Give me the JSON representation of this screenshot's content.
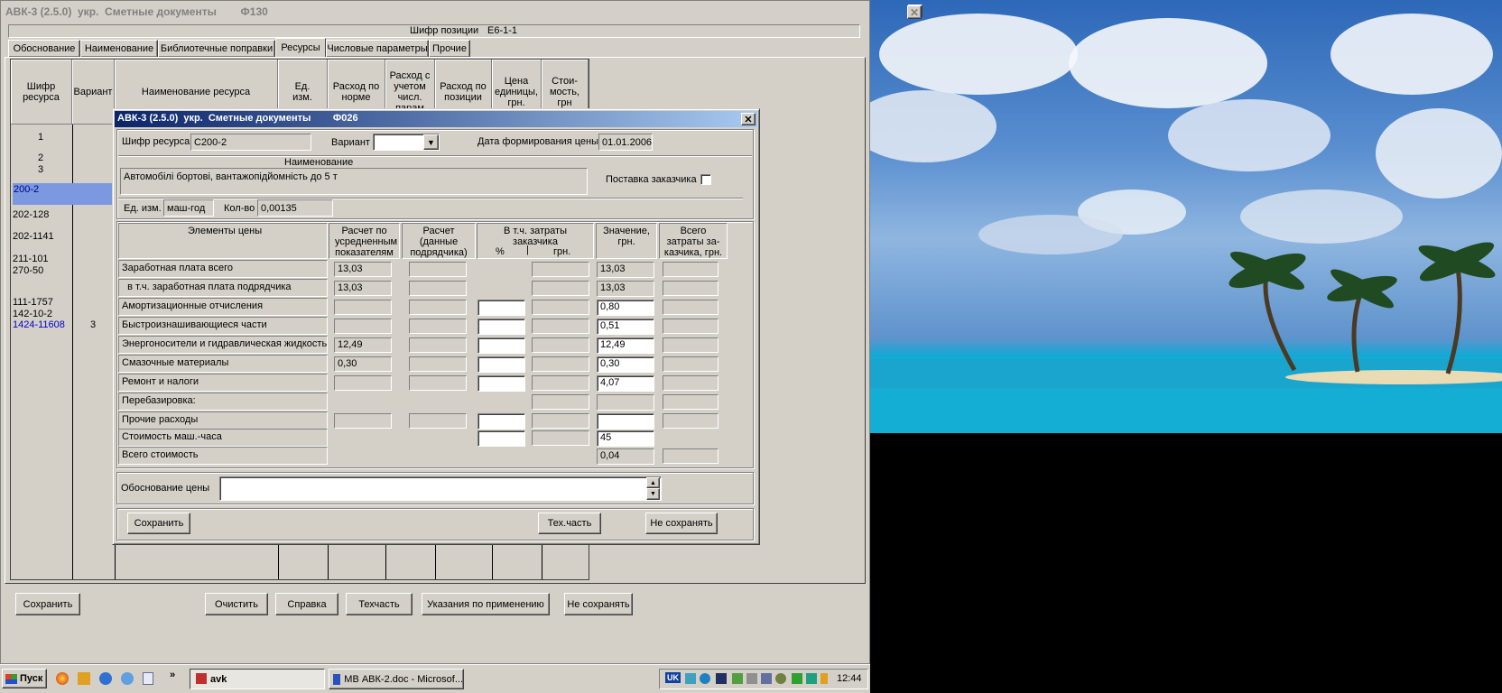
{
  "main_window": {
    "title": "АВК-3 (2.5.0)  укр.  Сметные документы        Ф130",
    "position_code_label": "Шифр позиции",
    "position_code": "Е6-1-1",
    "tabs": [
      "Обоснование",
      "Наименование",
      "Библиотечные поправки",
      "Ресурсы",
      "Числовые параметры",
      "Прочие"
    ],
    "active_tab": "Ресурсы",
    "table_headers": [
      "Шифр ресурса",
      "Вариант",
      "Наименование ресурса",
      "Ед. изм.",
      "Расход по норме",
      "Расход с учетом числ. парам",
      "Расход по позиции",
      "Цена единицы, грн.",
      "Стои- мость, грн"
    ],
    "resource_rows": [
      {
        "code": "1",
        "variant": ""
      },
      {
        "code": "2",
        "variant": ""
      },
      {
        "code": "3",
        "variant": ""
      },
      {
        "code": "200-2",
        "variant": "",
        "selected": true
      },
      {
        "code": "202-128",
        "variant": ""
      },
      {
        "code": "202-1141",
        "variant": ""
      },
      {
        "code": "211-101",
        "variant": ""
      },
      {
        "code": "270-50",
        "variant": ""
      },
      {
        "code": "111-1757",
        "variant": ""
      },
      {
        "code": "142-10-2",
        "variant": ""
      },
      {
        "code": "1424-11608",
        "variant": "3",
        "blue": true
      }
    ],
    "buttons": {
      "save": "Сохранить",
      "clear": "Очистить",
      "help": "Справка",
      "techpart": "Техчасть",
      "usage": "Указания по применению",
      "nosave": "Не сохранять"
    }
  },
  "dialog": {
    "title": "АВК-3 (2.5.0)  укр.  Сметные документы        Ф026",
    "resource_code_label": "Шифр ресурса",
    "resource_code": "С200-2",
    "variant_label": "Вариант",
    "variant_value": "",
    "price_date_label": "Дата формирования цены",
    "price_date": "01.01.2006",
    "name_label": "Наименование",
    "name_value": "Автомобілі бортові, вантажопідйомність до 5 т",
    "customer_supply_label": "Поставка заказчика",
    "unit_label": "Ед. изм.",
    "unit_value": "маш-год",
    "qty_label": "Кол-во",
    "qty_value": "0,00135",
    "grid_headers": {
      "elements": "Элементы цены",
      "avg_calc": "Расчет по усредненным показателям",
      "contractor_calc": "Расчет (данные подрядчика)",
      "customer_costs": "В т.ч. затраты заказчика",
      "pct": "%",
      "uah": "грн.",
      "value": "Значение, грн.",
      "total_customer": "Всего затраты за- казчика, грн."
    },
    "grid_rows": [
      {
        "label": "Заработная плата всего",
        "avg": "13,03",
        "value": "13,03"
      },
      {
        "label": "  в т.ч. заработная плата подрядчика",
        "avg": "13,03",
        "value": "13,03"
      },
      {
        "label": "Амортизационные отчисления",
        "avg": "",
        "value": "0,80"
      },
      {
        "label": "Быстроизнашивающиеся части",
        "avg": "",
        "value": "0,51"
      },
      {
        "label": "Энергоносители и гидравлическая жидкость",
        "avg": "12,49",
        "value": "12,49"
      },
      {
        "label": "Смазочные материалы",
        "avg": "0,30",
        "value": "0,30"
      },
      {
        "label": "Ремонт и налоги",
        "avg": "",
        "value": "4,07"
      },
      {
        "label": "Перебазировка:",
        "avg": "",
        "value": ""
      },
      {
        "label": "Прочие расходы",
        "avg": "",
        "value": ""
      },
      {
        "label": "Стоимость маш.-часа",
        "avg": "",
        "value": "45"
      },
      {
        "label": "Всего стоимость",
        "avg": "",
        "value": "0,04"
      }
    ],
    "price_basis_label": "Обоснование цены",
    "price_basis_value": "",
    "buttons": {
      "save": "Сохранить",
      "techpart": "Тех.часть",
      "nosave": "Не сохранять"
    }
  },
  "taskbar": {
    "start": "Пуск",
    "tasks": [
      "avk",
      "МВ АВК-2.doc - Microsof..."
    ],
    "lang": "UK",
    "clock": "12:44"
  }
}
